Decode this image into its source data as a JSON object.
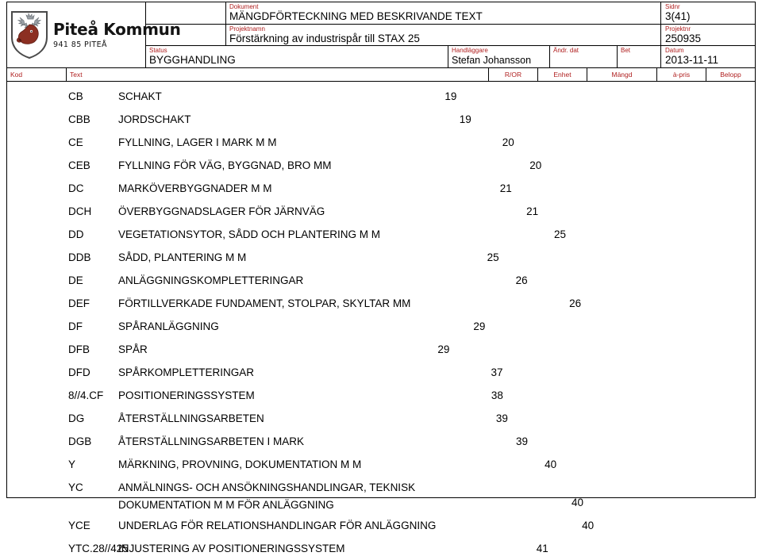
{
  "document": {
    "organization": {
      "name": "Piteå Kommun",
      "address": "941 85  PITEÅ",
      "crest_icon": "moose-head-crest-icon"
    },
    "fields": {
      "dokument_label": "Dokument",
      "dokument_value": "MÄNGDFÖRTECKNING MED BESKRIVANDE TEXT",
      "projektnamn_label": "Projektnamn",
      "projektnamn_value": "Förstärkning av industrispår till STAX 25",
      "status_label": "Status",
      "status_value": "BYGGHANDLING",
      "handlaggare_label": "Handläggare",
      "handlaggare_value": "Stefan Johansson",
      "andr_dat_label": "Ändr. dat",
      "andr_dat_value": "",
      "bet_label": "Bet",
      "bet_value": "",
      "sidnr_label": "Sidnr",
      "sidnr_value": "3(41)",
      "projektnr_label": "Projektnr",
      "projektnr_value": "250935",
      "datum_label": "Datum",
      "datum_value": "2013-11-11"
    }
  },
  "table": {
    "columns": {
      "kod": "Kod",
      "text": "Text",
      "ror": "R/OR",
      "enhet": "Enhet",
      "mangd": "Mängd",
      "apris": "à-pris",
      "belopp": "Belopp"
    },
    "rows": [
      {
        "kod": "CB",
        "text": "SCHAKT",
        "text2": "",
        "page": "19"
      },
      {
        "kod": "CBB",
        "text": "JORDSCHAKT",
        "text2": "",
        "page": "19"
      },
      {
        "kod": "CE",
        "text": "FYLLNING, LAGER I MARK M M",
        "text2": "",
        "page": "20"
      },
      {
        "kod": "CEB",
        "text": "FYLLNING FÖR VÄG, BYGGNAD, BRO MM",
        "text2": "",
        "page": "20"
      },
      {
        "kod": "DC",
        "text": "MARKÖVERBYGGNADER M M",
        "text2": "",
        "page": "21"
      },
      {
        "kod": "DCH",
        "text": "ÖVERBYGGNADSLAGER FÖR JÄRNVÄG",
        "text2": "",
        "page": "21"
      },
      {
        "kod": "DD",
        "text": "VEGETATIONSYTOR, SÅDD OCH PLANTERING M M",
        "text2": "",
        "page": "25"
      },
      {
        "kod": "DDB",
        "text": "SÅDD, PLANTERING M M",
        "text2": "",
        "page": "25"
      },
      {
        "kod": "DE",
        "text": "ANLÄGGNINGSKOMPLETTERINGAR",
        "text2": "",
        "page": "26"
      },
      {
        "kod": "DEF",
        "text": "FÖRTILLVERKADE FUNDAMENT, STOLPAR, SKYLTAR MM",
        "text2": "",
        "page": "26"
      },
      {
        "kod": "DF",
        "text": "SPÅRANLÄGGNING",
        "text2": "",
        "page": "29"
      },
      {
        "kod": "DFB",
        "text": "SPÅR",
        "text2": "",
        "page": "29"
      },
      {
        "kod": "DFD",
        "text": "SPÅRKOMPLETTERINGAR",
        "text2": "",
        "page": "37"
      },
      {
        "kod": "8//4.CF",
        "text": "POSITIONERINGSSYSTEM",
        "text2": "",
        "page": "38"
      },
      {
        "kod": "DG",
        "text": "ÅTERSTÄLLNINGSARBETEN",
        "text2": "",
        "page": "39"
      },
      {
        "kod": "DGB",
        "text": "ÅTERSTÄLLNINGSARBETEN I MARK",
        "text2": "",
        "page": "39"
      },
      {
        "kod": "Y",
        "text": "MÄRKNING, PROVNING, DOKUMENTATION M M",
        "text2": "",
        "page": "40"
      },
      {
        "kod": "YC",
        "text": "ANMÄLNINGS- OCH ANSÖKNINGSHANDLINGAR, TEKNISK",
        "text2": "DOKUMENTATION M M FÖR ANLÄGGNING",
        "page": "40"
      },
      {
        "kod": "YCE",
        "text": "UNDERLAG FÖR RELATIONSHANDLINGAR FÖR ANLÄGGNING",
        "text2": "",
        "page": "40"
      },
      {
        "kod": "YTC.28//425",
        "text": "INJUSTERING AV POSITIONERINGSSYSTEM",
        "text2": "",
        "page": "41"
      }
    ]
  },
  "colors": {
    "label_red": "#b02020",
    "crest_body": "#8c2f22",
    "crest_antler": "#9aa0a6",
    "border": "#000000",
    "text": "#000000"
  }
}
